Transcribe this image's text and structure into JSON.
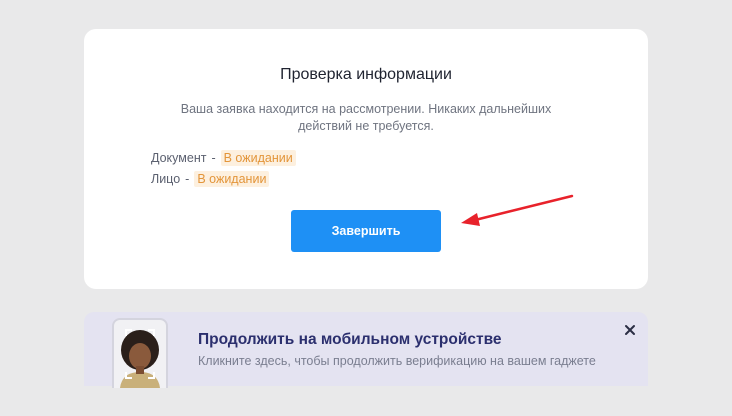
{
  "verification": {
    "title": "Проверка информации",
    "description": "Ваша заявка находится на рассмотрении. Никаких дальнейших действий не требуется.",
    "statuses": [
      {
        "label": "Документ",
        "separator": "-",
        "value": "В ожидании"
      },
      {
        "label": "Лицо",
        "separator": "-",
        "value": "В ожидании"
      }
    ],
    "finish_label": "Завершить"
  },
  "mobile_banner": {
    "title": "Продолжить на мобильном устройстве",
    "subtitle": "Кликните здесь, чтобы продолжить верификацию на вашем гаджете",
    "close_icon": "close-icon",
    "phone_icon": "phone-face-scan-icon"
  },
  "annotation": {
    "icon": "red-arrow-icon",
    "color": "#e8222b"
  },
  "colors": {
    "accent": "#1e90f5",
    "pending_text": "#e3953a",
    "pending_bg": "#fdf0df"
  }
}
